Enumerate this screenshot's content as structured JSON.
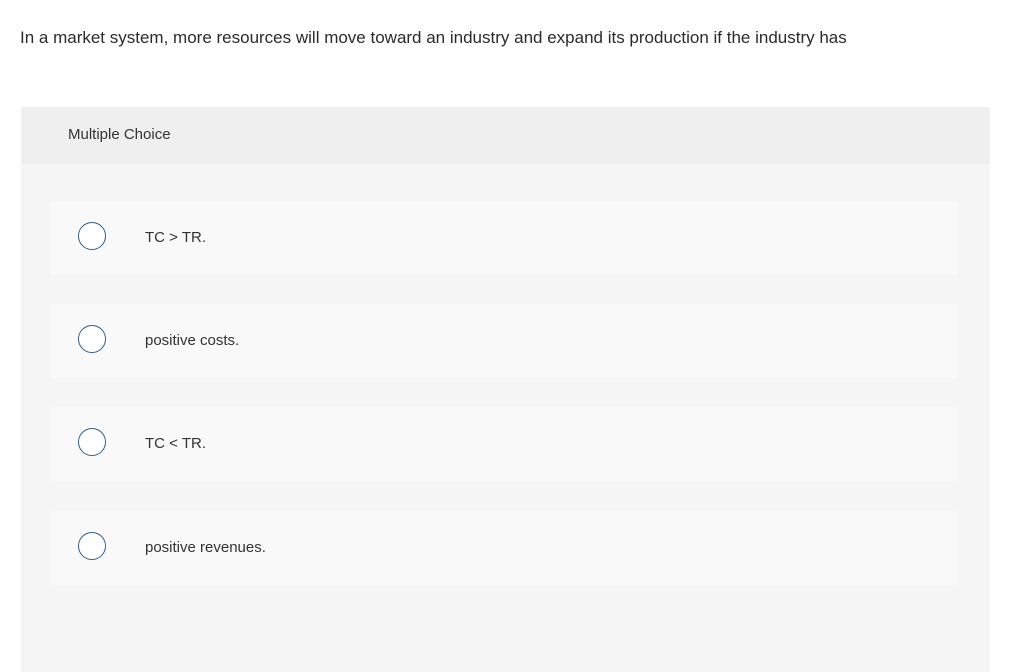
{
  "question": {
    "text": "In a market system, more resources will move toward an industry and expand its production if the industry has"
  },
  "panel": {
    "header_label": "Multiple Choice"
  },
  "options": [
    {
      "label": "TC > TR."
    },
    {
      "label": "positive costs."
    },
    {
      "label": "TC < TR."
    },
    {
      "label": "positive revenues."
    }
  ],
  "colors": {
    "radio_border": "#2f5f8a",
    "panel_bg": "#f5f5f5",
    "header_bg": "#efefef",
    "option_bg": "#f9f9f9"
  }
}
